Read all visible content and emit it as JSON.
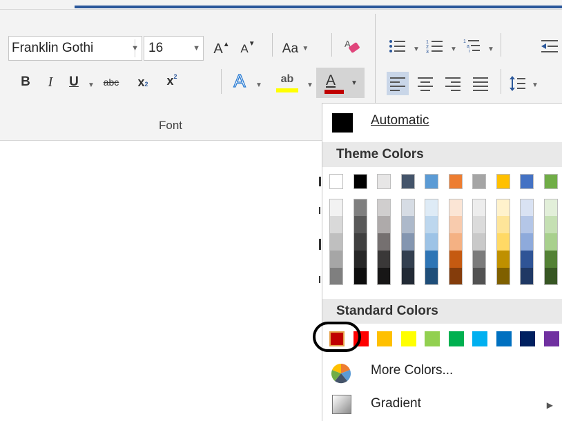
{
  "ribbon": {
    "font_name": "Franklin Gothi",
    "font_size": "16",
    "change_case_label": "Aa",
    "grow_font_label": "A",
    "shrink_font_label": "A",
    "bold_label": "B",
    "italic_label": "I",
    "underline_label": "U",
    "strike_label": "abc",
    "subscript_label": "x",
    "superscript_label": "x",
    "sub_mark": "2",
    "sup_mark": "2",
    "effects_label": "A",
    "highlight_label": "ab",
    "font_color_label": "A",
    "group_label": "Font",
    "font_color_bar": "#c00000",
    "highlight_bar": "#ffff00"
  },
  "color_menu": {
    "automatic_label": "Automatic",
    "theme_header": "Theme Colors",
    "standard_header": "Standard Colors",
    "more_colors_label": "More Colors...",
    "gradient_label": "Gradient",
    "theme_base": [
      "#ffffff",
      "#000000",
      "#e7e6e6",
      "#44546a",
      "#5b9bd5",
      "#ed7d31",
      "#a5a5a5",
      "#ffc000",
      "#4472c4",
      "#70ad47"
    ],
    "theme_shades": [
      [
        "#f2f2f2",
        "#d9d9d9",
        "#bfbfbf",
        "#a6a6a6",
        "#7f7f7f"
      ],
      [
        "#7f7f7f",
        "#595959",
        "#404040",
        "#262626",
        "#0d0d0d"
      ],
      [
        "#d0cece",
        "#aeaaaa",
        "#757070",
        "#3a3838",
        "#171616"
      ],
      [
        "#d6dce4",
        "#adb9ca",
        "#8496b0",
        "#333f4f",
        "#222a35"
      ],
      [
        "#deebf6",
        "#bdd7ee",
        "#9dc3e6",
        "#2e75b5",
        "#1f4e79"
      ],
      [
        "#fbe5d5",
        "#f8cbad",
        "#f4b183",
        "#c55a11",
        "#843c0b"
      ],
      [
        "#ededed",
        "#dbdbdb",
        "#c9c9c9",
        "#7b7b7b",
        "#525252"
      ],
      [
        "#fff2cc",
        "#fee599",
        "#ffd965",
        "#bf9000",
        "#7f6000"
      ],
      [
        "#d9e2f3",
        "#b4c6e7",
        "#8eaadb",
        "#2f5496",
        "#1f3864"
      ],
      [
        "#e2efd9",
        "#c5e0b3",
        "#a8d08d",
        "#538135",
        "#375623"
      ]
    ],
    "standard": [
      "#c00000",
      "#ff0000",
      "#ffc000",
      "#ffff00",
      "#92d050",
      "#00b050",
      "#00b0f0",
      "#0070c0",
      "#002060",
      "#7030a0"
    ]
  }
}
